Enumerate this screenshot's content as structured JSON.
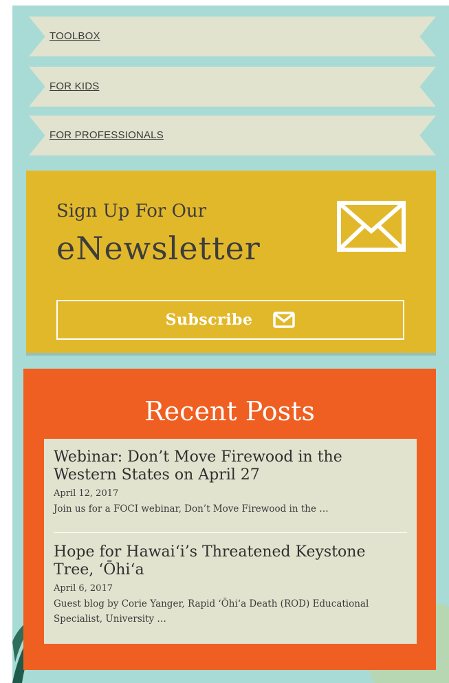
{
  "nav": {
    "items": [
      {
        "label": "TOOLBOX"
      },
      {
        "label": "FOR KIDS"
      },
      {
        "label": "FOR PROFESSIONALS"
      }
    ]
  },
  "newsletter": {
    "heading_small": "Sign Up For Our",
    "heading_big": "eNewsletter",
    "subscribe_label": "Subscribe",
    "icon": "envelope-icon"
  },
  "recent_posts": {
    "title": "Recent Posts",
    "posts": [
      {
        "title": "Webinar: Don’t Move Firewood in the Western States on April 27",
        "date": "April 12, 2017",
        "excerpt": "Join us for a FOCI webinar, Don’t Move Firewood in the …"
      },
      {
        "title": "Hope for Hawai‘i’s Threatened Keystone Tree, ‘Ōhi‘a",
        "date": "April 6, 2017",
        "excerpt": "Guest blog by Corie Yanger, Rapid ‘Ōhi‘a Death (ROD) Educational Specialist, University …"
      }
    ]
  },
  "colors": {
    "background": "#a8dbd5",
    "nav_ribbon": "#e2e3cf",
    "newsletter": "#e2b82b",
    "recent_posts": "#f05f22"
  }
}
